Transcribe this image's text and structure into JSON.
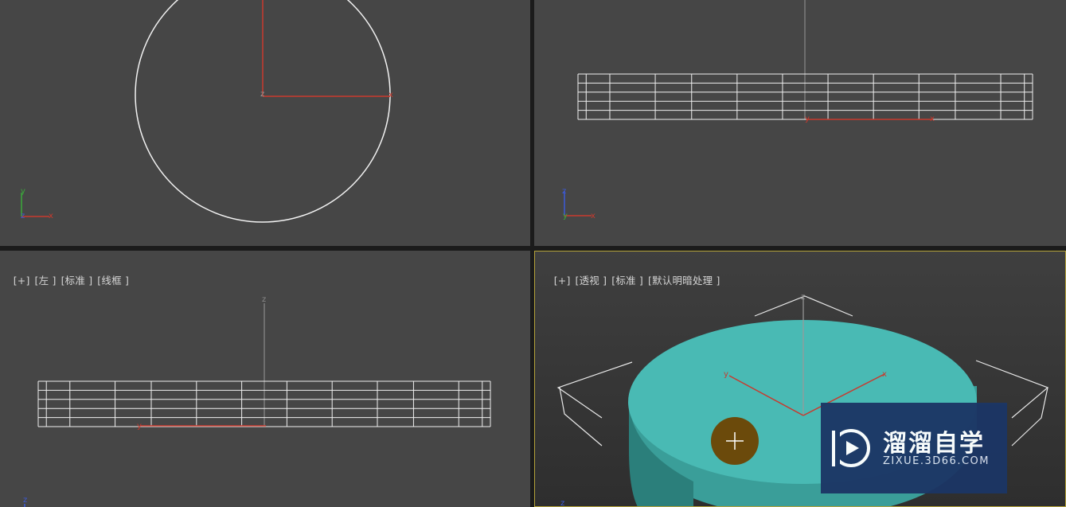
{
  "viewports": {
    "left": {
      "labels": [
        "[+]",
        "[左 ]",
        "[标准 ]",
        "[线框 ]"
      ]
    },
    "perspective": {
      "labels": [
        "[+]",
        "[透视 ]",
        "[标准 ]",
        "[默认明暗处理 ]"
      ]
    }
  },
  "axis_letters": {
    "x": "x",
    "y": "y",
    "z": "z"
  },
  "watermark": {
    "title": "溜溜自学",
    "url": "ZIXUE.3D66.COM"
  },
  "colors": {
    "viewport_bg": "#464646",
    "active_border": "#b4a23a",
    "cylinder": "#4bbfb9",
    "gizmo_red": "#c0392b"
  }
}
